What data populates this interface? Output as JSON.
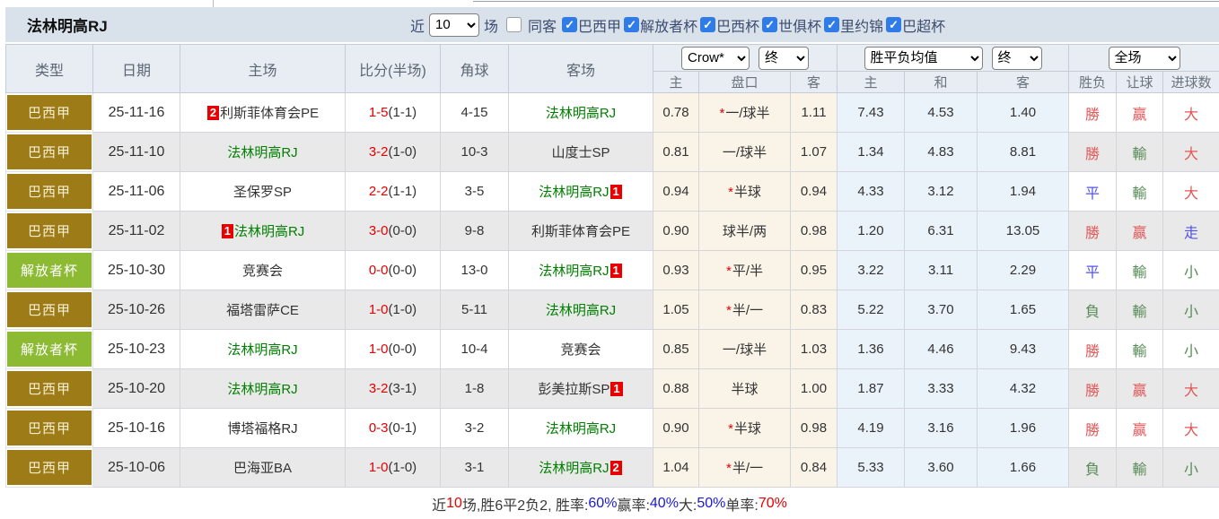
{
  "header": {
    "team_name": "法林明高RJ",
    "near_label": "近",
    "near_count": "10",
    "matches_label": "场",
    "same_away_label": "同客",
    "same_away_checked": false,
    "leagues": [
      {
        "label": "巴西甲",
        "checked": true
      },
      {
        "label": "解放者杯",
        "checked": true
      },
      {
        "label": "巴西杯",
        "checked": true
      },
      {
        "label": "世俱杯",
        "checked": true
      },
      {
        "label": "里约锦",
        "checked": true
      },
      {
        "label": "巴超杯",
        "checked": true
      }
    ]
  },
  "icons": {
    "check": "✓",
    "star": "*",
    "dropdown": "chevron-down-icon"
  },
  "table": {
    "left_headers": [
      "类型",
      "日期",
      "主场",
      "比分(半场)",
      "角球",
      "客场"
    ],
    "selects": {
      "company": "Crow*",
      "company_state": "终",
      "avg": "胜平负均值",
      "avg_state": "终",
      "scope": "全场"
    },
    "sub_headers": [
      "主",
      "盘口",
      "客",
      "主",
      "和",
      "客",
      "胜负",
      "让球",
      "进球数"
    ],
    "rows": [
      {
        "league": "巴西甲",
        "league_style": "gold",
        "date": "25-11-16",
        "home": {
          "name": "利斯菲体育会PE",
          "focus": false,
          "badge": "2",
          "badge_pos": "before"
        },
        "score": "1-5",
        "half": "(1-1)",
        "corner": "4-15",
        "away": {
          "name": "法林明高RJ",
          "focus": true
        },
        "handicap": {
          "home": "0.78",
          "star": true,
          "line": "一/球半",
          "away": "1.11"
        },
        "avg": {
          "home": "7.43",
          "draw": "4.53",
          "away": "1.40"
        },
        "results": [
          {
            "text": "勝",
            "c": "red"
          },
          {
            "text": "赢",
            "c": "red"
          },
          {
            "text": "大",
            "c": "red"
          }
        ]
      },
      {
        "league": "巴西甲",
        "league_style": "gold",
        "date": "25-11-10",
        "home": {
          "name": "法林明高RJ",
          "focus": true
        },
        "score": "3-2",
        "half": "(1-0)",
        "corner": "10-3",
        "away": {
          "name": "山度士SP",
          "focus": false
        },
        "handicap": {
          "home": "0.81",
          "star": false,
          "line": "一/球半",
          "away": "1.07"
        },
        "avg": {
          "home": "1.34",
          "draw": "4.83",
          "away": "8.81"
        },
        "results": [
          {
            "text": "勝",
            "c": "red"
          },
          {
            "text": "輸",
            "c": "green"
          },
          {
            "text": "大",
            "c": "red"
          }
        ]
      },
      {
        "league": "巴西甲",
        "league_style": "gold",
        "date": "25-11-06",
        "home": {
          "name": "圣保罗SP",
          "focus": false
        },
        "score": "2-2",
        "half": "(1-1)",
        "corner": "3-5",
        "away": {
          "name": "法林明高RJ",
          "focus": true,
          "badge": "1",
          "badge_pos": "after"
        },
        "handicap": {
          "home": "0.94",
          "star": true,
          "line": "半球",
          "away": "0.94"
        },
        "avg": {
          "home": "4.33",
          "draw": "3.12",
          "away": "1.94"
        },
        "results": [
          {
            "text": "平",
            "c": "blue"
          },
          {
            "text": "輸",
            "c": "green"
          },
          {
            "text": "大",
            "c": "red"
          }
        ]
      },
      {
        "league": "巴西甲",
        "league_style": "gold",
        "date": "25-11-02",
        "home": {
          "name": "法林明高RJ",
          "focus": true,
          "badge": "1",
          "badge_pos": "before"
        },
        "score": "3-0",
        "half": "(0-0)",
        "corner": "9-8",
        "away": {
          "name": "利斯菲体育会PE",
          "focus": false
        },
        "handicap": {
          "home": "0.90",
          "star": false,
          "line": "球半/两",
          "away": "0.98"
        },
        "avg": {
          "home": "1.20",
          "draw": "6.31",
          "away": "13.05"
        },
        "results": [
          {
            "text": "勝",
            "c": "red"
          },
          {
            "text": "赢",
            "c": "red"
          },
          {
            "text": "走",
            "c": "blue"
          }
        ]
      },
      {
        "league": "解放者杯",
        "league_style": "green",
        "date": "25-10-30",
        "home": {
          "name": "竞赛会",
          "focus": false
        },
        "score": "0-0",
        "half": "(0-0)",
        "corner": "13-0",
        "away": {
          "name": "法林明高RJ",
          "focus": true,
          "badge": "1",
          "badge_pos": "after"
        },
        "handicap": {
          "home": "0.93",
          "star": true,
          "line": "平/半",
          "away": "0.95"
        },
        "avg": {
          "home": "3.22",
          "draw": "3.11",
          "away": "2.29"
        },
        "results": [
          {
            "text": "平",
            "c": "blue"
          },
          {
            "text": "輸",
            "c": "green"
          },
          {
            "text": "小",
            "c": "green"
          }
        ]
      },
      {
        "league": "巴西甲",
        "league_style": "gold",
        "date": "25-10-26",
        "home": {
          "name": "福塔雷萨CE",
          "focus": false
        },
        "score": "1-0",
        "half": "(1-0)",
        "corner": "5-11",
        "away": {
          "name": "法林明高RJ",
          "focus": true
        },
        "handicap": {
          "home": "1.05",
          "star": true,
          "line": "半/一",
          "away": "0.83"
        },
        "avg": {
          "home": "5.22",
          "draw": "3.70",
          "away": "1.65"
        },
        "results": [
          {
            "text": "負",
            "c": "green"
          },
          {
            "text": "輸",
            "c": "green"
          },
          {
            "text": "小",
            "c": "green"
          }
        ]
      },
      {
        "league": "解放者杯",
        "league_style": "green",
        "date": "25-10-23",
        "home": {
          "name": "法林明高RJ",
          "focus": true
        },
        "score": "1-0",
        "half": "(0-0)",
        "corner": "10-4",
        "away": {
          "name": "竞赛会",
          "focus": false
        },
        "handicap": {
          "home": "0.85",
          "star": false,
          "line": "一/球半",
          "away": "1.03"
        },
        "avg": {
          "home": "1.36",
          "draw": "4.46",
          "away": "9.43"
        },
        "results": [
          {
            "text": "勝",
            "c": "red"
          },
          {
            "text": "輸",
            "c": "green"
          },
          {
            "text": "小",
            "c": "green"
          }
        ]
      },
      {
        "league": "巴西甲",
        "league_style": "gold",
        "date": "25-10-20",
        "home": {
          "name": "法林明高RJ",
          "focus": true
        },
        "score": "3-2",
        "half": "(3-1)",
        "corner": "1-8",
        "away": {
          "name": "彭美拉斯SP",
          "focus": false,
          "badge": "1",
          "badge_pos": "after"
        },
        "handicap": {
          "home": "0.88",
          "star": false,
          "line": "半球",
          "away": "1.00"
        },
        "avg": {
          "home": "1.87",
          "draw": "3.33",
          "away": "4.32"
        },
        "results": [
          {
            "text": "勝",
            "c": "red"
          },
          {
            "text": "赢",
            "c": "red"
          },
          {
            "text": "大",
            "c": "red"
          }
        ]
      },
      {
        "league": "巴西甲",
        "league_style": "gold",
        "date": "25-10-16",
        "home": {
          "name": "博塔福格RJ",
          "focus": false
        },
        "score": "0-3",
        "half": "(0-1)",
        "corner": "3-2",
        "away": {
          "name": "法林明高RJ",
          "focus": true
        },
        "handicap": {
          "home": "0.90",
          "star": true,
          "line": "半球",
          "away": "0.98"
        },
        "avg": {
          "home": "4.19",
          "draw": "3.16",
          "away": "1.96"
        },
        "results": [
          {
            "text": "勝",
            "c": "red"
          },
          {
            "text": "赢",
            "c": "red"
          },
          {
            "text": "大",
            "c": "red"
          }
        ]
      },
      {
        "league": "巴西甲",
        "league_style": "gold",
        "date": "25-10-06",
        "home": {
          "name": "巴海亚BA",
          "focus": false
        },
        "score": "1-0",
        "half": "(1-0)",
        "corner": "3-1",
        "away": {
          "name": "法林明高RJ",
          "focus": true,
          "badge": "2",
          "badge_pos": "after"
        },
        "handicap": {
          "home": "1.04",
          "star": true,
          "line": "半/一",
          "away": "0.84"
        },
        "avg": {
          "home": "5.33",
          "draw": "3.60",
          "away": "1.66"
        },
        "results": [
          {
            "text": "負",
            "c": "green"
          },
          {
            "text": "輸",
            "c": "green"
          },
          {
            "text": "小",
            "c": "green"
          }
        ]
      }
    ]
  },
  "footer": {
    "segments": [
      {
        "text": "近",
        "color": "dark"
      },
      {
        "text": "10",
        "color": "red"
      },
      {
        "text": "场,胜6平2负2, 胜率:",
        "color": "dark"
      },
      {
        "text": "60%",
        "color": "blue"
      },
      {
        "text": " 赢率:",
        "color": "dark"
      },
      {
        "text": "40%",
        "color": "blue"
      },
      {
        "text": " 大:",
        "color": "dark"
      },
      {
        "text": "50%",
        "color": "blue"
      },
      {
        "text": " 单率:",
        "color": "dark"
      },
      {
        "text": "70%",
        "color": "red"
      }
    ]
  },
  "colors": {
    "league-gold": "#9d7b16",
    "league-green": "#8cba33",
    "team-green": "#008000",
    "score-red": "#e60000",
    "res-red": "#e15757",
    "res-blue": "#5353e6",
    "res-green": "#568a56",
    "cream-bg": "#faf4e8",
    "blue-bg": "#eaf3fa",
    "checkbox-blue": "#2f7ce8",
    "stat-blue": "#1919d6"
  }
}
